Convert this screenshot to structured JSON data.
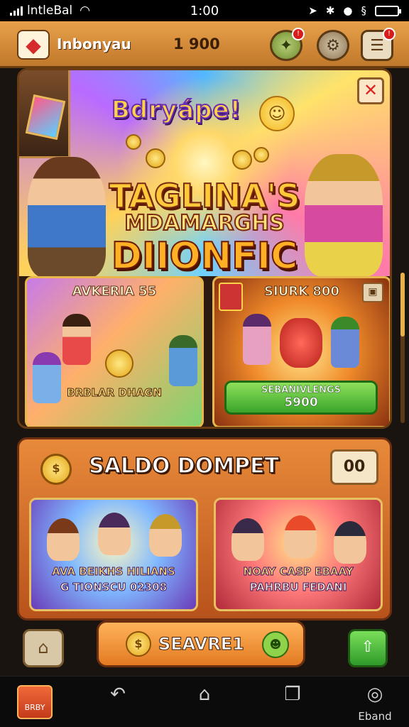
{
  "status_bar": {
    "carrier": "lntleBal",
    "time": "1:00"
  },
  "header": {
    "username": "Inbonyau",
    "coins": "1 900",
    "notification_count": "!"
  },
  "banner": {
    "promo_word": "Bdryápe!",
    "title_line1": "TAGLINA'S",
    "title_line2": "MDAMARGHS",
    "title_line3": "DIIONFIC"
  },
  "cards": {
    "left": {
      "title": "AVKERIA 55",
      "subtitle": "BRBLAR DHAGN"
    },
    "right": {
      "title": "SIURK 800",
      "button_line1": "SEBANIVLENGS",
      "button_line2": "5900"
    }
  },
  "saldo": {
    "title": "SALDO DOMPET",
    "value": "00",
    "events": [
      {
        "line1": "AVA BEIKHS HILIANS",
        "line2": "G TIONSCU 02308"
      },
      {
        "line1": "NOAY CASP EBAAY",
        "line2": "PAHRBU FEDANI"
      }
    ]
  },
  "actions": {
    "search_label": "SEAVRE1"
  },
  "nav": {
    "home_label": "BRBY",
    "profile_label": "Eband"
  },
  "colors": {
    "accent": "#e88a3a",
    "header": "#c0782b",
    "success": "#3aa52a",
    "alert": "#d81c1c"
  }
}
